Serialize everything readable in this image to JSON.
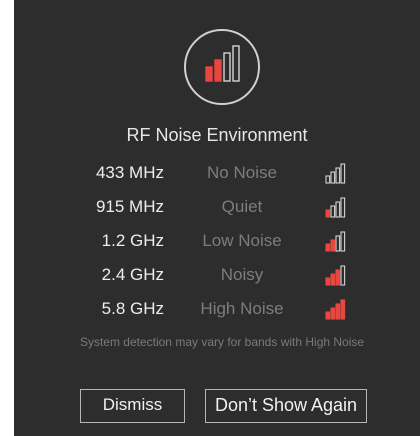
{
  "dialog": {
    "title": "RF Noise Environment",
    "hero_icon": "signal-strength-icon",
    "rows": [
      {
        "frequency": "433 MHz",
        "level": "No Noise",
        "bars_active": 0,
        "icon": "signal-bars-icon"
      },
      {
        "frequency": "915 MHz",
        "level": "Quiet",
        "bars_active": 1,
        "icon": "signal-bars-icon"
      },
      {
        "frequency": "1.2 GHz",
        "level": "Low Noise",
        "bars_active": 2,
        "icon": "signal-bars-icon"
      },
      {
        "frequency": "2.4 GHz",
        "level": "Noisy",
        "bars_active": 3,
        "icon": "signal-bars-icon"
      },
      {
        "frequency": "5.8 GHz",
        "level": "High Noise",
        "bars_active": 4,
        "icon": "signal-bars-icon"
      }
    ],
    "note": "System detection may vary for bands with High Noise",
    "dismiss_label": "Dismiss",
    "dont_show_label": "Don’t Show Again"
  },
  "colors": {
    "background": "#2d2d2d",
    "accent_red": "#e8463f",
    "outline": "#d4d4d4"
  }
}
